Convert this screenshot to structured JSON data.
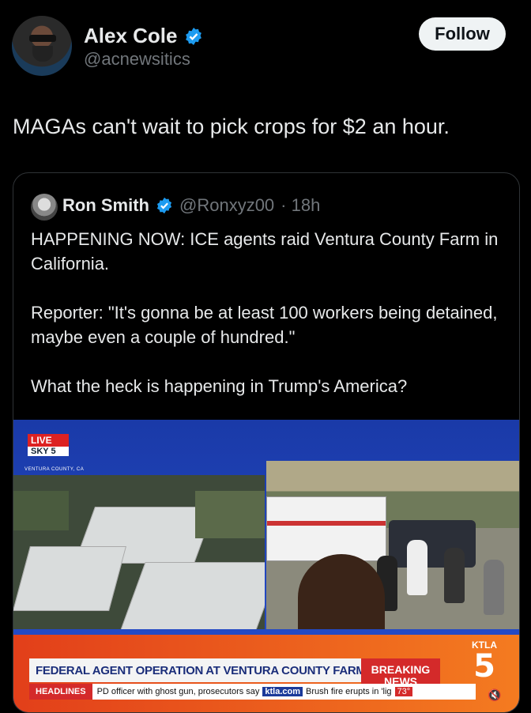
{
  "author": {
    "name": "Alex Cole",
    "handle": "@acnewsitics",
    "follow_label": "Follow"
  },
  "tweet": {
    "text": "MAGAs can't wait to pick crops for $2 an hour."
  },
  "quote": {
    "name": "Ron Smith",
    "handle": "@Ronxyz00",
    "time": "· 18h",
    "paragraphs": [
      "HAPPENING NOW: ICE agents raid Ventura County Farm in California.",
      "Reporter: \"It's gonna be at least 100 workers being detained, maybe even a couple of hundred.\"",
      "What the heck is happening in Trump's America?"
    ]
  },
  "video": {
    "live": "LIVE",
    "sky": "SKY 5",
    "location": "VENTURA COUNTY, CA",
    "headline": "FEDERAL AGENT OPERATION AT VENTURA COUNTY FARM",
    "breaking_1": "BREAKING",
    "breaking_2": "NEWS",
    "ticker_label": "HEADLINES",
    "ticker_text_1": "PD officer with ghost gun, prosecutors say",
    "ticker_site": "ktla.com",
    "ticker_text_2": "Brush fire erupts in 'lig",
    "temp": "73°",
    "station": "KTLA",
    "channel": "5"
  },
  "colors": {
    "verified": "#1d9bf0",
    "banner": "#e23f1a",
    "breaking": "#d42a2a"
  }
}
